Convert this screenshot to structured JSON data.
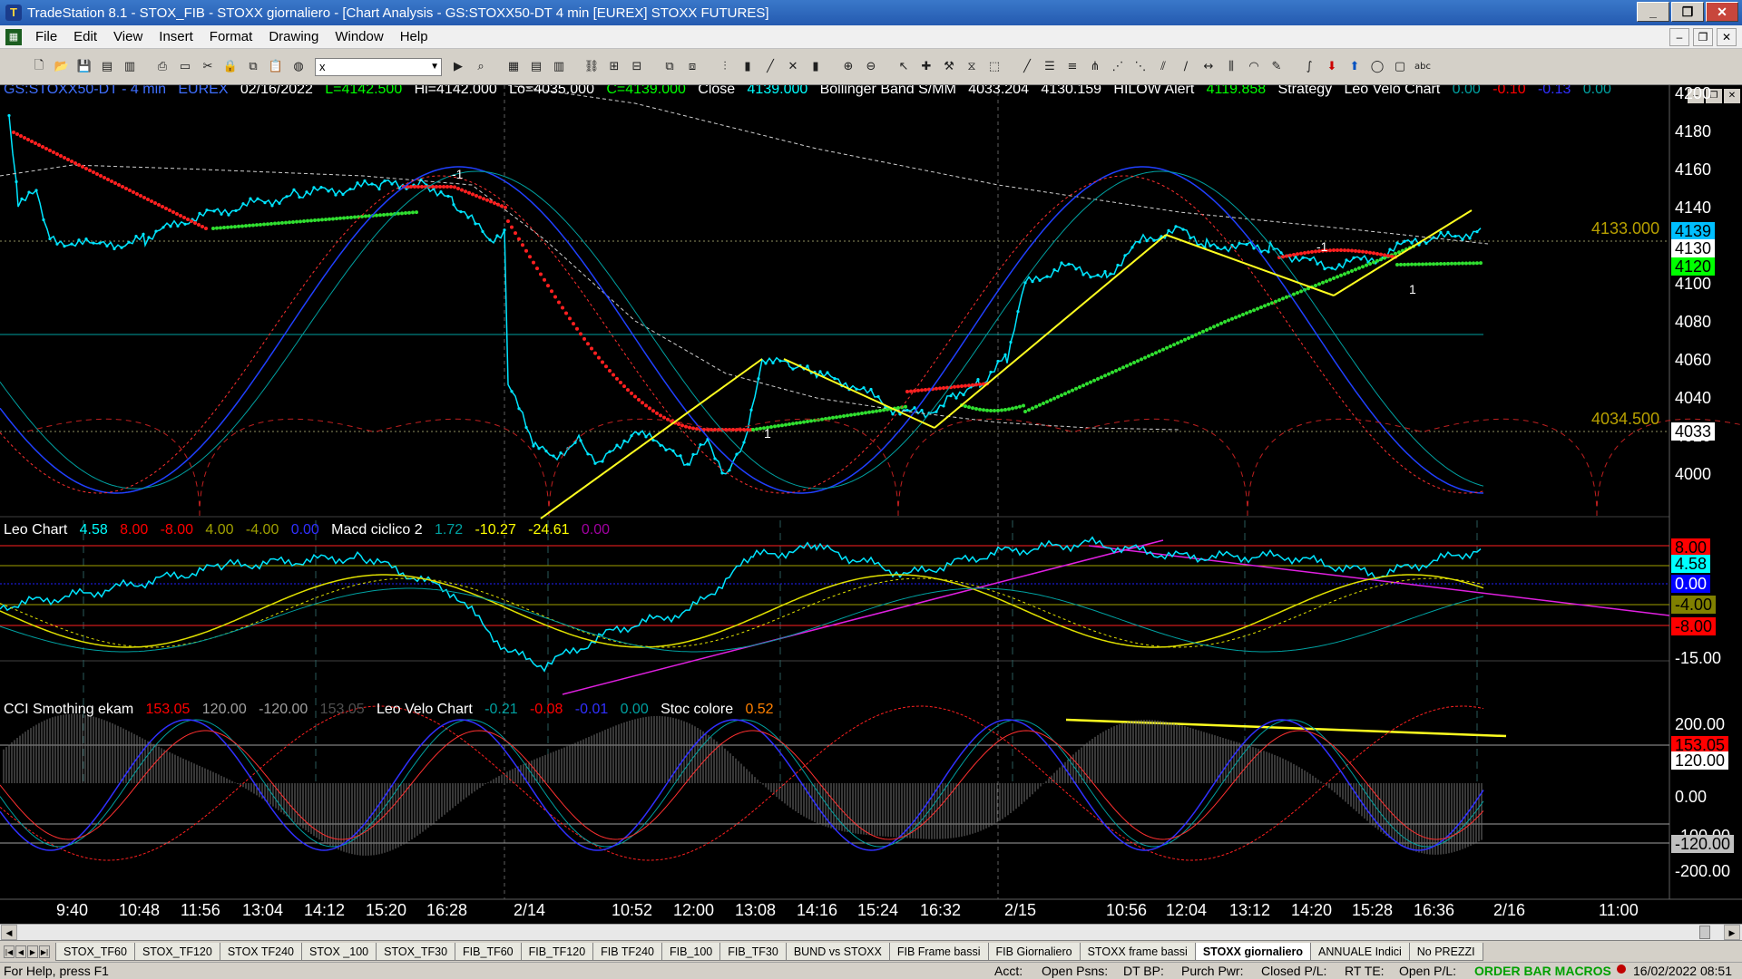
{
  "window": {
    "title": "TradeStation 8.1 - STOX_FIB - STOXX giornaliero - [Chart Analysis - GS:STOXX50-DT  4 min  [EUREX] STOXX FUTURES]"
  },
  "menu": [
    "File",
    "Edit",
    "View",
    "Insert",
    "Format",
    "Drawing",
    "Window",
    "Help"
  ],
  "toolbar": {
    "symbol_value": "x"
  },
  "price_panel": {
    "legend": [
      {
        "text": "GS:STOXX50-DT - 4 min",
        "color": "#3f6fff"
      },
      {
        "text": "EUREX",
        "color": "#3f6fff"
      },
      {
        "text": "02/16/2022",
        "color": "#ffffff"
      },
      {
        "text": "L=4142.500",
        "color": "#00ff00"
      },
      {
        "text": "Hi=4142.000",
        "color": "#ffffff"
      },
      {
        "text": "Lo=4035.000",
        "color": "#ffffff"
      },
      {
        "text": "C=4139.000",
        "color": "#00ff00"
      },
      {
        "text": "Close",
        "color": "#ffffff"
      },
      {
        "text": "4139.000",
        "color": "#00ffff"
      },
      {
        "text": "Bollinger Band S/MM",
        "color": "#ffffff"
      },
      {
        "text": "4033.204",
        "color": "#ffffff"
      },
      {
        "text": "4130.159",
        "color": "#ffffff"
      },
      {
        "text": "HILOW Alert",
        "color": "#ffffff"
      },
      {
        "text": "4119.858",
        "color": "#00ff00"
      },
      {
        "text": "Strategy",
        "color": "#ffffff"
      },
      {
        "text": "Leo Velo Chart",
        "color": "#ffffff"
      },
      {
        "text": "0.00",
        "color": "#00a0a0"
      },
      {
        "text": "-0.10",
        "color": "#ff0000"
      },
      {
        "text": "-0.13",
        "color": "#3030ff"
      },
      {
        "text": "0.00",
        "color": "#00a0a0"
      }
    ],
    "axis": [
      "4200",
      "4180",
      "4160",
      "4140",
      "4120",
      "4100",
      "4080",
      "4060",
      "4040",
      "4020",
      "4000"
    ],
    "level_high": "4133.000",
    "level_low": "4034.500",
    "tags": [
      {
        "text": "4139",
        "bg": "#00bfff",
        "color": "#000000"
      },
      {
        "text": "4130",
        "bg": "#ffffff",
        "color": "#000000"
      },
      {
        "text": "4120",
        "bg": "#00ff00",
        "color": "#000000"
      },
      {
        "text": "4033",
        "bg": "#ffffff",
        "color": "#000000"
      }
    ],
    "markers": [
      "-1",
      "1",
      "-1",
      "1"
    ]
  },
  "macd_panel": {
    "legend": [
      {
        "text": "Leo Chart",
        "color": "#ffffff"
      },
      {
        "text": "4.58",
        "color": "#00ffff"
      },
      {
        "text": "8.00",
        "color": "#ff0000"
      },
      {
        "text": "-8.00",
        "color": "#ff0000"
      },
      {
        "text": "4.00",
        "color": "#a0a000"
      },
      {
        "text": "-4.00",
        "color": "#a0a000"
      },
      {
        "text": "0.00",
        "color": "#3030ff"
      },
      {
        "text": "Macd ciclico 2",
        "color": "#ffffff"
      },
      {
        "text": "1.72",
        "color": "#00a0a0"
      },
      {
        "text": "-10.27",
        "color": "#ffff00"
      },
      {
        "text": "-24.61",
        "color": "#ffff00"
      },
      {
        "text": "0.00",
        "color": "#a000a0"
      }
    ],
    "tags": [
      {
        "text": "8.00",
        "bg": "#ff0000",
        "color": "#000000"
      },
      {
        "text": "4.58",
        "bg": "#00ffff",
        "color": "#000000"
      },
      {
        "text": "0.00",
        "bg": "#0000ff",
        "color": "#ffffff"
      },
      {
        "text": "-4.00",
        "bg": "#808000",
        "color": "#000000"
      },
      {
        "text": "-8.00",
        "bg": "#ff0000",
        "color": "#000000"
      }
    ],
    "axis_extra": "-15.00"
  },
  "cci_panel": {
    "legend": [
      {
        "text": "CCI Smothing ekam",
        "color": "#ffffff"
      },
      {
        "text": "153.05",
        "color": "#ff0000"
      },
      {
        "text": "120.00",
        "color": "#a0a0a0"
      },
      {
        "text": "-120.00",
        "color": "#a0a0a0"
      },
      {
        "text": "153.05",
        "color": "#505050"
      },
      {
        "text": "Leo Velo Chart",
        "color": "#ffffff"
      },
      {
        "text": "-0.21",
        "color": "#00a0a0"
      },
      {
        "text": "-0.08",
        "color": "#ff0000"
      },
      {
        "text": "-0.01",
        "color": "#3030ff"
      },
      {
        "text": "0.00",
        "color": "#00a0a0"
      },
      {
        "text": "Stoc colore",
        "color": "#ffffff"
      },
      {
        "text": "0.52",
        "color": "#ff8000"
      }
    ],
    "axis": [
      "200.00",
      "0.00",
      "-200.00"
    ],
    "tags": [
      {
        "text": "153.05",
        "bg": "#ff0000",
        "color": "#000000"
      },
      {
        "text": "120.00",
        "bg": "#ffffff",
        "color": "#000000"
      },
      {
        "text": "-100.00",
        "bg": "#000000",
        "color": "#ffffff"
      },
      {
        "text": "-120.00",
        "bg": "#c0c0c0",
        "color": "#000000"
      }
    ]
  },
  "time_axis": [
    "9:40",
    "10:48",
    "11:56",
    "13:04",
    "14:12",
    "15:20",
    "16:28",
    "2/14",
    "10:52",
    "12:00",
    "13:08",
    "14:16",
    "15:24",
    "16:32",
    "2/15",
    "10:56",
    "12:04",
    "13:12",
    "14:20",
    "15:28",
    "16:36",
    "2/16",
    "11:00"
  ],
  "tabs": [
    "STOX_TF60",
    "STOX_TF120",
    "STOX TF240",
    "STOX _100",
    "STOX_TF30",
    "FIB_TF60",
    "FIB_TF120",
    "FIB TF240",
    "FIB_100",
    "FIB_TF30",
    "BUND vs STOXX",
    "FIB Frame bassi",
    "FIB Giornaliero",
    "STOXX frame bassi",
    "STOXX giornaliero",
    "ANNUALE Indici",
    "No PREZZI"
  ],
  "active_tab": "STOXX giornaliero",
  "status": {
    "help": "For Help, press F1",
    "fields": [
      "Acct:",
      "Open Psns:",
      "DT BP:",
      "Purch Pwr:",
      "Closed P/L:",
      "RT TE:",
      "Open P/L:"
    ],
    "orderbar": "ORDER BAR  MACROS",
    "clock": "16/02/2022 08:51"
  }
}
